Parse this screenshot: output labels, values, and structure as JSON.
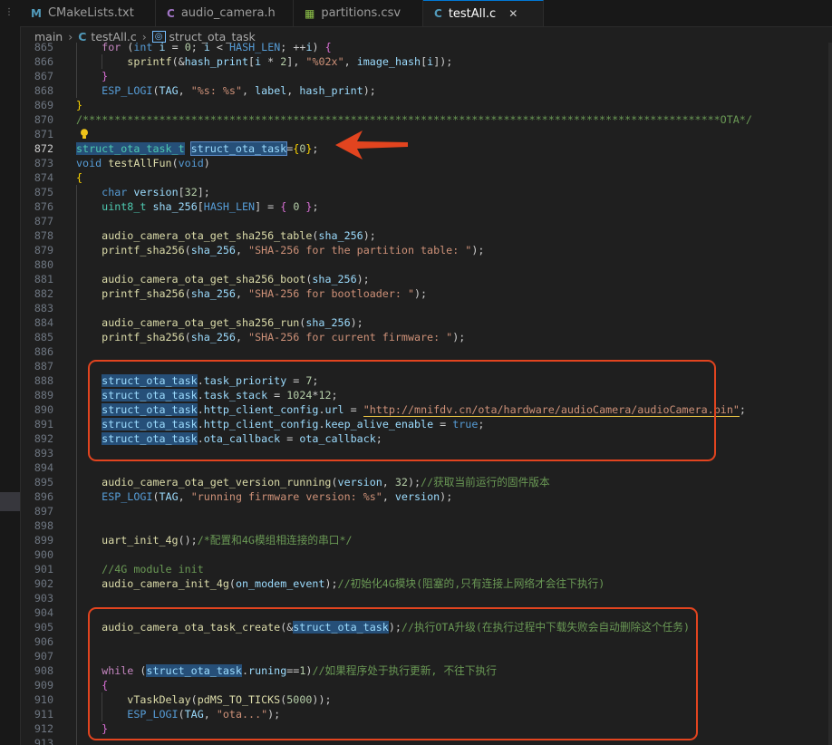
{
  "tabs": [
    {
      "label": "CMakeLists.txt",
      "icon": "M",
      "icon_color": "#519aba",
      "active": false
    },
    {
      "label": "audio_camera.h",
      "icon": "C",
      "icon_color": "#a074c4",
      "active": false
    },
    {
      "label": "partitions.csv",
      "icon": "▦",
      "icon_color": "#8dc149",
      "active": false
    },
    {
      "label": "testAll.c",
      "icon": "C",
      "icon_color": "#519aba",
      "active": true
    }
  ],
  "breadcrumb": {
    "folder": "main",
    "file": "testAll.c",
    "symbol": "struct_ota_task"
  },
  "current_line": "872",
  "lines": [
    {
      "n": "865",
      "html": "    <span class=\"ctl\">for</span> (<span class=\"kw\">int</span> <span class=\"var\">i</span> = <span class=\"num\">0</span>; <span class=\"var\">i</span> &lt; <span class=\"mac\">HASH_LEN</span>; ++<span class=\"var\">i</span>) <span class=\"br2\">{</span>"
    },
    {
      "n": "866",
      "html": "        <span class=\"fn\">sprintf</span>(&amp;<span class=\"var\">hash_print</span>[<span class=\"var\">i</span> * <span class=\"num\">2</span>], <span class=\"str\">\"%02x\"</span>, <span class=\"var\">image_hash</span>[<span class=\"var\">i</span>]);"
    },
    {
      "n": "867",
      "html": "    <span class=\"br2\">}</span>"
    },
    {
      "n": "868",
      "html": "    <span class=\"mac\">ESP_LOGI</span>(<span class=\"var\">TAG</span>, <span class=\"str\">\"%s: %s\"</span>, <span class=\"var\">label</span>, <span class=\"var\">hash_print</span>);"
    },
    {
      "n": "869",
      "html": "<span class=\"br1\">}</span>"
    },
    {
      "n": "870",
      "html": "<span class=\"cmt\">/****************************************************************************************************OTA*/</span>"
    },
    {
      "n": "871",
      "html": ""
    },
    {
      "n": "872",
      "html": "<span class=\"ty sel\">struct_ota_task_t</span> <span class=\"var selb\">struct_ota_task</span>=<span class=\"br1\">{</span><span class=\"num\">0</span><span class=\"br1\">}</span>;"
    },
    {
      "n": "873",
      "html": "<span class=\"kw\">void</span> <span class=\"fn\">testAllFun</span>(<span class=\"kw\">void</span>)"
    },
    {
      "n": "874",
      "html": "<span class=\"br1\">{</span>"
    },
    {
      "n": "875",
      "html": "    <span class=\"kw\">char</span> <span class=\"var\">version</span>[<span class=\"num\">32</span>];"
    },
    {
      "n": "876",
      "html": "    <span class=\"ty\">uint8_t</span> <span class=\"var\">sha_256</span>[<span class=\"mac\">HASH_LEN</span>] = <span class=\"br2\">{</span> <span class=\"num\">0</span> <span class=\"br2\">}</span>;"
    },
    {
      "n": "877",
      "html": ""
    },
    {
      "n": "878",
      "html": "    <span class=\"fn\">audio_camera_ota_get_sha256_table</span>(<span class=\"var\">sha_256</span>);"
    },
    {
      "n": "879",
      "html": "    <span class=\"fn\">printf_sha256</span>(<span class=\"var\">sha_256</span>, <span class=\"str\">\"SHA-256 for the partition table: \"</span>);"
    },
    {
      "n": "880",
      "html": ""
    },
    {
      "n": "881",
      "html": "    <span class=\"fn\">audio_camera_ota_get_sha256_boot</span>(<span class=\"var\">sha_256</span>);"
    },
    {
      "n": "882",
      "html": "    <span class=\"fn\">printf_sha256</span>(<span class=\"var\">sha_256</span>, <span class=\"str\">\"SHA-256 for bootloader: \"</span>);"
    },
    {
      "n": "883",
      "html": ""
    },
    {
      "n": "884",
      "html": "    <span class=\"fn\">audio_camera_ota_get_sha256_run</span>(<span class=\"var\">sha_256</span>);"
    },
    {
      "n": "885",
      "html": "    <span class=\"fn\">printf_sha256</span>(<span class=\"var\">sha_256</span>, <span class=\"str\">\"SHA-256 for current firmware: \"</span>);"
    },
    {
      "n": "886",
      "html": ""
    },
    {
      "n": "887",
      "html": ""
    },
    {
      "n": "888",
      "html": "    <span class=\"var sel\">struct_ota_task</span>.<span class=\"var\">task_priority</span> = <span class=\"num\">7</span>;"
    },
    {
      "n": "889",
      "html": "    <span class=\"var sel\">struct_ota_task</span>.<span class=\"var\">task_stack</span> = <span class=\"num\">1024</span>*<span class=\"num\">12</span>;"
    },
    {
      "n": "890",
      "html": "    <span class=\"var sel\">struct_ota_task</span>.<span class=\"var\">http_client_config</span>.<span class=\"var\">url</span> = <span class=\"str ul\">\"http://mnifdv.cn/ota/hardware/audioCamera/audioCamera.bin\"</span>;"
    },
    {
      "n": "891",
      "html": "    <span class=\"var sel\">struct_ota_task</span>.<span class=\"var\">http_client_config</span>.<span class=\"var\">keep_alive_enable</span> = <span class=\"kw\">true</span>;"
    },
    {
      "n": "892",
      "html": "    <span class=\"var sel\">struct_ota_task</span>.<span class=\"var\">ota_callback</span> = <span class=\"var\">ota_callback</span>;"
    },
    {
      "n": "893",
      "html": ""
    },
    {
      "n": "894",
      "html": ""
    },
    {
      "n": "895",
      "html": "    <span class=\"fn\">audio_camera_ota_get_version_running</span>(<span class=\"var\">version</span>, <span class=\"num\">32</span>);<span class=\"cmt\">//获取当前运行的固件版本</span>"
    },
    {
      "n": "896",
      "html": "    <span class=\"mac\">ESP_LOGI</span>(<span class=\"var\">TAG</span>, <span class=\"str\">\"running firmware version: %s\"</span>, <span class=\"var\">version</span>);"
    },
    {
      "n": "897",
      "html": ""
    },
    {
      "n": "898",
      "html": ""
    },
    {
      "n": "899",
      "html": "    <span class=\"fn\">uart_init_4g</span>();<span class=\"cmt\">/*配置和4G模组相连接的串口*/</span>"
    },
    {
      "n": "900",
      "html": ""
    },
    {
      "n": "901",
      "html": "    <span class=\"cmt\">//4G module init</span>"
    },
    {
      "n": "902",
      "html": "    <span class=\"fn\">audio_camera_init_4g</span>(<span class=\"var\">on_modem_event</span>);<span class=\"cmt\">//初始化4G模块(阻塞的,只有连接上网络才会往下执行)</span>"
    },
    {
      "n": "903",
      "html": ""
    },
    {
      "n": "904",
      "html": ""
    },
    {
      "n": "905",
      "html": "    <span class=\"fn\">audio_camera_ota_task_create</span>(&amp;<span class=\"var sel\">struct_ota_task</span>);<span class=\"cmt\">//执行OTA升级(在执行过程中下载失败会自动删除这个任务)</span>"
    },
    {
      "n": "906",
      "html": ""
    },
    {
      "n": "907",
      "html": ""
    },
    {
      "n": "908",
      "html": "    <span class=\"ctl\">while</span> (<span class=\"var sel\">struct_ota_task</span>.<span class=\"var\">runing</span>==<span class=\"num\">1</span>)<span class=\"cmt\">//如果程序处于执行更新, 不往下执行</span>"
    },
    {
      "n": "909",
      "html": "    <span class=\"br2\">{</span>"
    },
    {
      "n": "910",
      "html": "        <span class=\"fn\">vTaskDelay</span>(<span class=\"fn\">pdMS_TO_TICKS</span>(<span class=\"num\">5000</span>));"
    },
    {
      "n": "911",
      "html": "        <span class=\"mac\">ESP_LOGI</span>(<span class=\"var\">TAG</span>, <span class=\"str\">\"ota...\"</span>);"
    },
    {
      "n": "912",
      "html": "    <span class=\"br2\">}</span>"
    },
    {
      "n": "913",
      "html": ""
    }
  ]
}
